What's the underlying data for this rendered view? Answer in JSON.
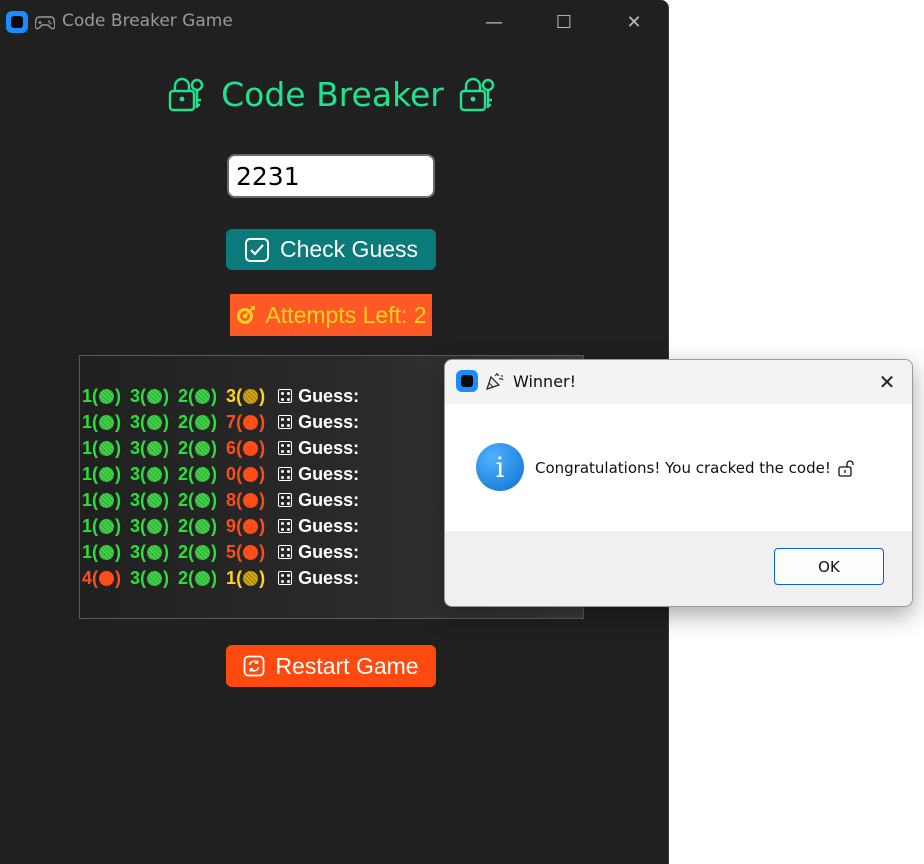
{
  "window": {
    "title": "Code Breaker Game",
    "controls": [
      "minimize",
      "maximize",
      "close"
    ]
  },
  "game": {
    "heading": "Code Breaker",
    "guess_value": "2231",
    "check_label": "Check Guess",
    "attempts_label": "Attempts Left: 2",
    "restart_label": "Restart Game",
    "guess_word": "Guess:",
    "history": [
      [
        {
          "d": "1",
          "s": "green"
        },
        {
          "d": "3",
          "s": "green"
        },
        {
          "d": "2",
          "s": "green"
        },
        {
          "d": "3",
          "s": "yellow"
        }
      ],
      [
        {
          "d": "1",
          "s": "green"
        },
        {
          "d": "3",
          "s": "green"
        },
        {
          "d": "2",
          "s": "green"
        },
        {
          "d": "7",
          "s": "red"
        }
      ],
      [
        {
          "d": "1",
          "s": "green"
        },
        {
          "d": "3",
          "s": "green"
        },
        {
          "d": "2",
          "s": "green"
        },
        {
          "d": "6",
          "s": "red"
        }
      ],
      [
        {
          "d": "1",
          "s": "green"
        },
        {
          "d": "3",
          "s": "green"
        },
        {
          "d": "2",
          "s": "green"
        },
        {
          "d": "0",
          "s": "red"
        }
      ],
      [
        {
          "d": "1",
          "s": "green"
        },
        {
          "d": "3",
          "s": "green"
        },
        {
          "d": "2",
          "s": "green"
        },
        {
          "d": "8",
          "s": "red"
        }
      ],
      [
        {
          "d": "1",
          "s": "green"
        },
        {
          "d": "3",
          "s": "green"
        },
        {
          "d": "2",
          "s": "green"
        },
        {
          "d": "9",
          "s": "red"
        }
      ],
      [
        {
          "d": "1",
          "s": "green"
        },
        {
          "d": "3",
          "s": "green"
        },
        {
          "d": "2",
          "s": "green"
        },
        {
          "d": "5",
          "s": "red"
        }
      ],
      [
        {
          "d": "4",
          "s": "red"
        },
        {
          "d": "3",
          "s": "green"
        },
        {
          "d": "2",
          "s": "green"
        },
        {
          "d": "1",
          "s": "yellow"
        }
      ]
    ]
  },
  "dialog": {
    "title": "Winner!",
    "message": "Congratulations! You cracked the code!",
    "ok_label": "OK"
  },
  "colors": {
    "accent_green": "#1fe38f",
    "check_button": "#0b7a7a",
    "attempts_bg": "#ff5a26",
    "restart_button": "#ff4a0f"
  },
  "icons": [
    "app-icon",
    "gamepad-icon",
    "lock-key-icon",
    "checkbox-icon",
    "target-icon",
    "dice-icon",
    "refresh-icon",
    "party-popper-icon",
    "info-icon",
    "unlock-icon"
  ]
}
